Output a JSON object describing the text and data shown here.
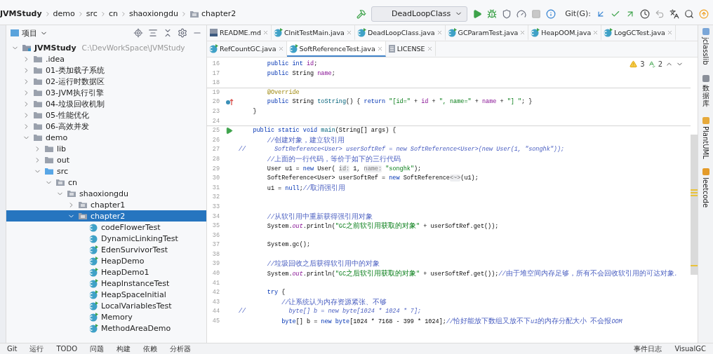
{
  "breadcrumbs": [
    {
      "label": "JVMStudy",
      "kind": "module"
    },
    {
      "label": "demo",
      "kind": "plain"
    },
    {
      "label": "src",
      "kind": "plain"
    },
    {
      "label": "cn",
      "kind": "plain"
    },
    {
      "label": "shaoxiongdu",
      "kind": "plain"
    },
    {
      "label": "chapter2",
      "kind": "folder"
    }
  ],
  "run_config": "DeadLoopClass",
  "git_label": "Git(G):",
  "project_panel": {
    "title": "项目"
  },
  "tree": [
    {
      "label": "JVMStudy",
      "path": "C:\\DevWorkSpace\\JVMStudy",
      "kind": "module",
      "expanded": true,
      "selected": false,
      "children": [
        {
          "label": ".idea",
          "kind": "folder",
          "expanded": false,
          "selected": false
        },
        {
          "label": "01-类加载子系统",
          "kind": "folder",
          "expanded": false,
          "selected": false
        },
        {
          "label": "02-运行时数据区",
          "kind": "folder",
          "expanded": false,
          "selected": false
        },
        {
          "label": "03-JVM执行引擎",
          "kind": "folder",
          "expanded": false,
          "selected": false
        },
        {
          "label": "04-垃圾回收机制",
          "kind": "folder",
          "expanded": false,
          "selected": false
        },
        {
          "label": "05-性能优化",
          "kind": "folder",
          "expanded": false,
          "selected": false
        },
        {
          "label": "06-高效并发",
          "kind": "folder",
          "expanded": false,
          "selected": false
        },
        {
          "label": "demo",
          "kind": "folder",
          "expanded": true,
          "selected": false,
          "children": [
            {
              "label": "lib",
              "kind": "folder",
              "expanded": false,
              "selected": false
            },
            {
              "label": "out",
              "kind": "folder",
              "expanded": false,
              "selected": false
            },
            {
              "label": "src",
              "kind": "source",
              "expanded": true,
              "selected": false,
              "children": [
                {
                  "label": "cn",
                  "kind": "package",
                  "expanded": true,
                  "selected": false,
                  "children": [
                    {
                      "label": "shaoxiongdu",
                      "kind": "package",
                      "expanded": true,
                      "selected": false,
                      "children": [
                        {
                          "label": "chapter1",
                          "kind": "package",
                          "expanded": false,
                          "selected": false
                        },
                        {
                          "label": "chapter2",
                          "kind": "package",
                          "expanded": true,
                          "selected": true,
                          "children": [
                            {
                              "label": "codeFlowerTest",
                              "kind": "class",
                              "selected": false
                            },
                            {
                              "label": "DynamicLinkingTest",
                              "kind": "class",
                              "selected": false
                            },
                            {
                              "label": "EdenSurvivorTest",
                              "kind": "runnable",
                              "selected": false
                            },
                            {
                              "label": "HeapDemo",
                              "kind": "runnable",
                              "selected": false
                            },
                            {
                              "label": "HeapDemo1",
                              "kind": "runnable",
                              "selected": false
                            },
                            {
                              "label": "HeapInstanceTest",
                              "kind": "runnable",
                              "selected": false
                            },
                            {
                              "label": "HeapSpaceInitial",
                              "kind": "runnable",
                              "selected": false
                            },
                            {
                              "label": "LocalVariablesTest",
                              "kind": "runnable",
                              "selected": false
                            },
                            {
                              "label": "Memory",
                              "kind": "runnable",
                              "selected": false
                            },
                            {
                              "label": "MethodAreaDemo",
                              "kind": "runnable",
                              "selected": false
                            }
                          ]
                        }
                      ]
                    }
                  ]
                }
              ]
            }
          ]
        }
      ]
    }
  ],
  "tab_rows": [
    [
      {
        "label": "README.md",
        "kind": "md",
        "selected": false
      },
      {
        "label": "ClnitTestMain.java",
        "kind": "java",
        "selected": false
      },
      {
        "label": "DeadLoopClass.java",
        "kind": "java",
        "selected": false
      },
      {
        "label": "GCParamTest.java",
        "kind": "java",
        "selected": false
      },
      {
        "label": "HeapOOM.java",
        "kind": "java",
        "selected": false
      },
      {
        "label": "LogGCTest.java",
        "kind": "java",
        "selected": false
      }
    ],
    [
      {
        "label": "RefCountGC.java",
        "kind": "java",
        "selected": false
      },
      {
        "label": "SoftReferenceTest.java",
        "kind": "java",
        "selected": true
      },
      {
        "label": "LICENSE",
        "kind": "text",
        "selected": false
      }
    ]
  ],
  "inspections": {
    "warnings": "3",
    "typos": "2"
  },
  "code": [
    {
      "n": "16",
      "tokens": [
        {
          "kind": "kw",
          "t": "        public int "
        },
        {
          "kind": "field",
          "t": "id"
        },
        {
          "kind": "plain",
          "t": ";"
        }
      ]
    },
    {
      "n": "17",
      "tokens": [
        {
          "kind": "kw",
          "t": "        public "
        },
        {
          "kind": "plain",
          "t": "String "
        },
        {
          "kind": "field",
          "t": "name"
        },
        {
          "kind": "plain",
          "t": ";"
        }
      ]
    },
    {
      "n": "18",
      "sep": true
    },
    {
      "n": "19",
      "tokens": [
        {
          "kind": "annot",
          "t": "        @Override"
        }
      ]
    },
    {
      "n": "20",
      "marker": {
        "kind": "override"
      },
      "tokens": [
        {
          "kind": "kw",
          "t": "        public "
        },
        {
          "kind": "plain",
          "t": "String "
        },
        {
          "kind": "method",
          "t": "toString"
        },
        {
          "kind": "plain",
          "t": "() { "
        },
        {
          "kind": "kw",
          "t": "return "
        },
        {
          "kind": "str",
          "t": "\"[id=\""
        },
        {
          "kind": "plain",
          "t": " + "
        },
        {
          "kind": "field",
          "t": "id"
        },
        {
          "kind": "plain",
          "t": " + "
        },
        {
          "kind": "str",
          "t": "\", name=\""
        },
        {
          "kind": "plain",
          "t": " + "
        },
        {
          "kind": "field",
          "t": "name"
        },
        {
          "kind": "plain",
          "t": " + "
        },
        {
          "kind": "str",
          "t": "\"] \""
        },
        {
          "kind": "plain",
          "t": "; }"
        }
      ]
    },
    {
      "n": "23",
      "tokens": [
        {
          "kind": "plain",
          "t": "    }"
        }
      ]
    },
    {
      "n": "24",
      "sep": true
    },
    {
      "n": "25",
      "marker": {
        "kind": "run"
      },
      "tokens": [
        {
          "kind": "kw",
          "t": "    public static void "
        },
        {
          "kind": "method",
          "t": "main"
        },
        {
          "kind": "plain",
          "t": "(String[] args) {"
        }
      ]
    },
    {
      "n": "26",
      "tokens": [
        {
          "kind": "comment",
          "t": "        //创建对象，建立软引用"
        }
      ]
    },
    {
      "n": "27",
      "tokens": [
        {
          "kind": "comment",
          "t": "//        SoftReference<User> userSoftRef = new SoftReference<User>(new User(1, \"songhk\"));"
        }
      ]
    },
    {
      "n": "28",
      "tokens": [
        {
          "kind": "comment",
          "t": "        //上面的一行代码，等价于如下的三行代码"
        }
      ]
    },
    {
      "n": "29",
      "tokens": [
        {
          "kind": "plain",
          "t": "        User u1 = "
        },
        {
          "kind": "kw",
          "t": "new "
        },
        {
          "kind": "plain",
          "t": "User( "
        },
        {
          "kind": "hint",
          "t": "id:"
        },
        {
          "kind": "plain",
          "t": " 1, "
        },
        {
          "kind": "hint",
          "t": "name:"
        },
        {
          "kind": "str",
          "t": " \"songhk\""
        },
        {
          "kind": "plain",
          "t": ");"
        }
      ]
    },
    {
      "n": "30",
      "tokens": [
        {
          "kind": "plain",
          "t": "        SoftReference<User> userSoftRef = "
        },
        {
          "kind": "kw",
          "t": "new "
        },
        {
          "kind": "plain",
          "t": "SoftReference"
        },
        {
          "kind": "hint",
          "t": "<~>"
        },
        {
          "kind": "plain",
          "t": "(u1);"
        }
      ]
    },
    {
      "n": "31",
      "tokens": [
        {
          "kind": "plain",
          "t": "        u1 = "
        },
        {
          "kind": "kw",
          "t": "null"
        },
        {
          "kind": "plain",
          "t": ";"
        },
        {
          "kind": "comment",
          "t": "//取消强引用"
        }
      ]
    },
    {
      "n": "32"
    },
    {
      "n": "33"
    },
    {
      "n": "34",
      "tokens": [
        {
          "kind": "comment",
          "t": "        //从软引用中重新获得强引用对象"
        }
      ]
    },
    {
      "n": "35",
      "tokens": [
        {
          "kind": "plain",
          "t": "        System."
        },
        {
          "kind": "static",
          "t": "out"
        },
        {
          "kind": "plain",
          "t": ".println("
        },
        {
          "kind": "str",
          "t": "\"GC之前软引用获取的对象\""
        },
        {
          "kind": "plain",
          "t": " + userSoftRef.get());"
        }
      ]
    },
    {
      "n": "36"
    },
    {
      "n": "37",
      "tokens": [
        {
          "kind": "plain",
          "t": "        System.gc();"
        }
      ]
    },
    {
      "n": "38"
    },
    {
      "n": "39",
      "tokens": [
        {
          "kind": "comment",
          "t": "        //垃圾回收之后获得软引用中的对象"
        }
      ]
    },
    {
      "n": "40",
      "tokens": [
        {
          "kind": "plain",
          "t": "        System."
        },
        {
          "kind": "static",
          "t": "out"
        },
        {
          "kind": "plain",
          "t": ".println("
        },
        {
          "kind": "str",
          "t": "\"GC之后软引用获取的对象\""
        },
        {
          "kind": "plain",
          "t": " + userSoftRef.get());"
        },
        {
          "kind": "comment",
          "t": "//由于堆空间内存足够，所有不会回收软引用的可达对象."
        }
      ]
    },
    {
      "n": "41"
    },
    {
      "n": "42",
      "tokens": [
        {
          "kind": "kw",
          "t": "        try"
        },
        {
          "kind": "plain",
          "t": " {"
        }
      ]
    },
    {
      "n": "43",
      "tokens": [
        {
          "kind": "comment",
          "t": "            //让系统认为内存资源紧张、不够"
        }
      ]
    },
    {
      "n": "44",
      "tokens": [
        {
          "kind": "comment",
          "t": "//            byte[] b = new byte[1024 * 1024 * 7];"
        }
      ]
    },
    {
      "n": "45",
      "tokens": [
        {
          "kind": "kw",
          "t": "            byte"
        },
        {
          "kind": "plain",
          "t": "[] b = "
        },
        {
          "kind": "kw",
          "t": "new byte"
        },
        {
          "kind": "plain",
          "t": "[1024 * 7168 - 399 * 1024];"
        },
        {
          "kind": "comment",
          "t": "//恰好能放下数组又放不下u1的内存分配大小 不会报OOM"
        }
      ]
    }
  ],
  "side_tabs": [
    {
      "label": "jclasslib",
      "kind": "rotated"
    },
    {
      "label": "数据库",
      "kind": "stacked"
    },
    {
      "label": "PlantUML",
      "kind": "rotated"
    },
    {
      "label": "leetcode",
      "kind": "rotated"
    }
  ],
  "bottom_left": [
    "Git",
    "运行",
    "TODO",
    "问题",
    "构建",
    "依赖",
    "分析器"
  ],
  "bottom_right": [
    "事件日志",
    "VisualGC"
  ]
}
